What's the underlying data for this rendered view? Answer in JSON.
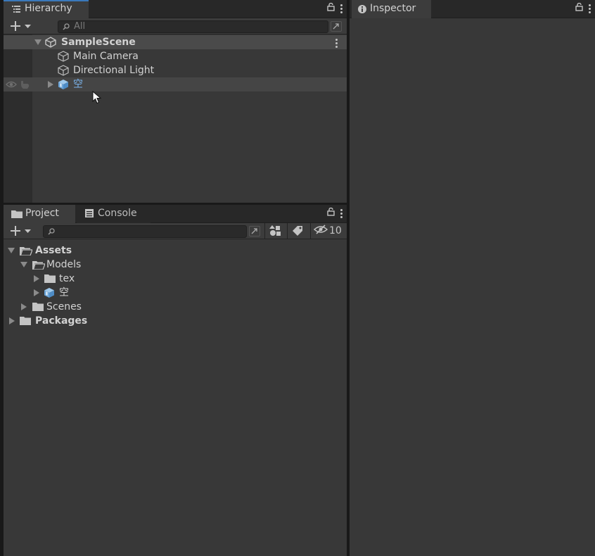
{
  "hierarchy": {
    "tab_label": "Hierarchy",
    "search_placeholder": "All",
    "scene": {
      "name": "SampleScene"
    },
    "items": [
      {
        "label": "Main Camera"
      },
      {
        "label": "Directional Light"
      },
      {
        "label": "空"
      }
    ]
  },
  "inspector": {
    "tab_label": "Inspector"
  },
  "project": {
    "tab_project": "Project",
    "tab_console": "Console",
    "hidden_count": "10",
    "tree": {
      "assets": "Assets",
      "models": "Models",
      "tex": "tex",
      "kong": "空",
      "scenes": "Scenes",
      "packages": "Packages"
    }
  },
  "colors": {
    "accent": "#3a79bb",
    "selected_text": "#7ab2ea",
    "panel_bg": "#383838"
  }
}
